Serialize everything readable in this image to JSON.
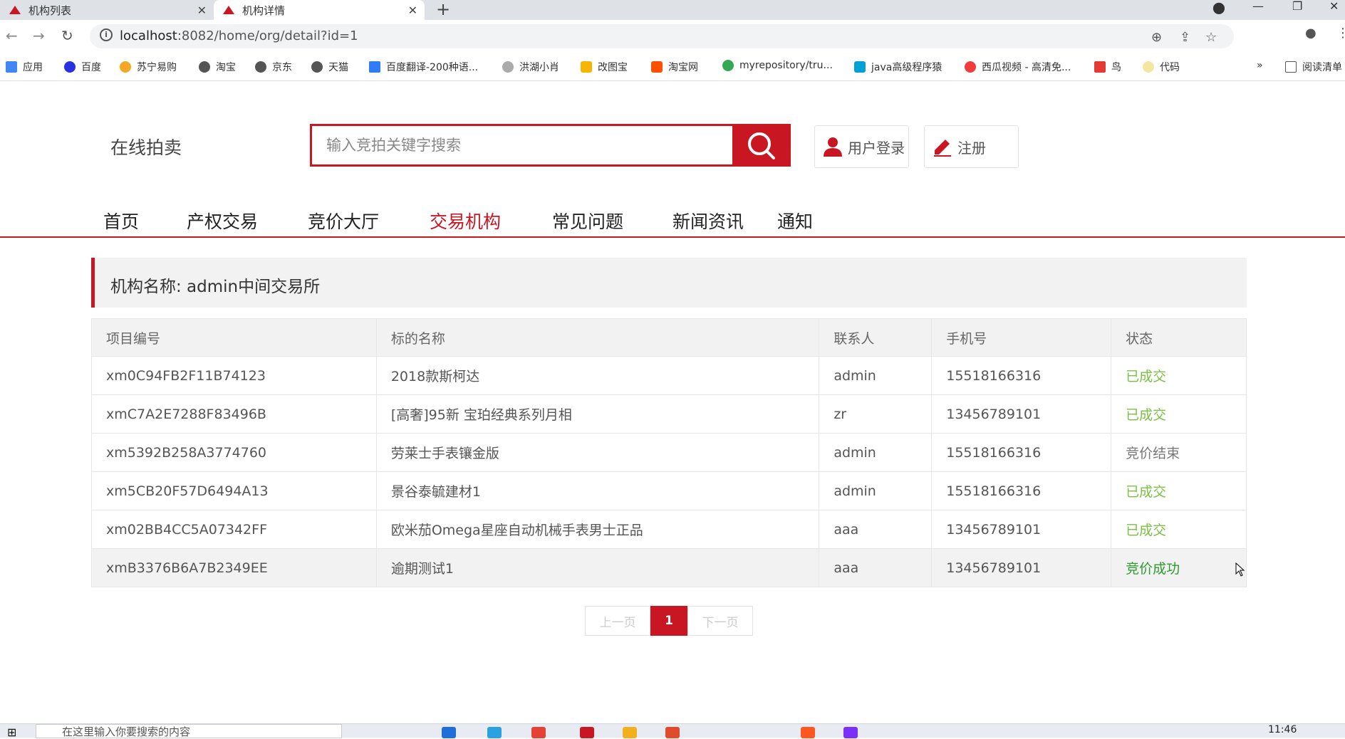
{
  "browser": {
    "tabs": [
      {
        "label": "机构列表"
      },
      {
        "label": "机构详情"
      }
    ],
    "url_host": "localhost",
    "url_rest": ":8082/home/org/detail?id=1",
    "bookmarks": [
      "应用",
      "百度",
      "苏宁易购",
      "淘宝",
      "京东",
      "天猫",
      "百度翻译-200种语...",
      "洪湖小肖",
      "改图宝",
      "淘宝网",
      "myrepository/tru...",
      "java高级程序猿",
      "西瓜视频 - 高清免...",
      "鸟",
      "代码"
    ],
    "reading_list": "阅读清单"
  },
  "header": {
    "brand": "在线拍卖",
    "search_placeholder": "输入竞拍关键字搜索",
    "login_label": "用户登录",
    "register_label": "注册"
  },
  "nav": {
    "items": [
      "首页",
      "产权交易",
      "竞价大厅",
      "交易机构",
      "常见问题",
      "新闻资讯",
      "通知"
    ],
    "active_index": 3
  },
  "org": {
    "title": "机构名称: admin中间交易所"
  },
  "table": {
    "columns": [
      "项目编号",
      "标的名称",
      "联系人",
      "手机号",
      "状态"
    ],
    "rows": [
      [
        "xm0C94FB2F11B74123",
        "2018款斯柯达",
        "admin",
        "15518166316",
        "已成交"
      ],
      [
        "xmC7A2E7288F83496B",
        "[高奢]95新 宝珀经典系列月相",
        "zr",
        "13456789101",
        "已成交"
      ],
      [
        "xm5392B258A3774760",
        "劳莱士手表镶金版",
        "admin",
        "15518166316",
        "竞价结束"
      ],
      [
        "xm5CB20F57D6494A13",
        "景谷泰毓建材1",
        "admin",
        "15518166316",
        "已成交"
      ],
      [
        "xm02BB4CC5A07342FF",
        "欧米茄Omega星座自动机械手表男士正品",
        "aaa",
        "13456789101",
        "已成交"
      ],
      [
        "xmB3376B6A7B2349EE",
        "逾期测试1",
        "aaa",
        "13456789101",
        "竞价成功"
      ]
    ]
  },
  "pager": {
    "prev": "上一页",
    "current": "1",
    "next": "下一页"
  },
  "taskbar": {
    "search_text": "在这里输入你要搜索的内容",
    "time": "11:46"
  },
  "colors": {
    "brand_red": "#c81623",
    "status_green": "#7ac143",
    "status_dark_green": "#2e9a2e"
  }
}
